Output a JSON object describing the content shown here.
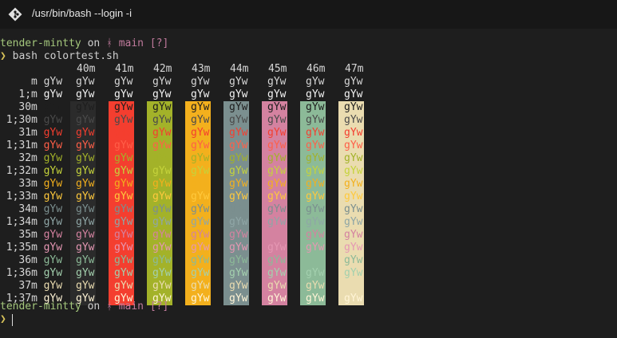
{
  "window": {
    "title": "/usr/bin/bash --login -i"
  },
  "prompt1": {
    "user": "tender-mintty",
    "on": "on",
    "branch_icon": "ᚼ",
    "branch": "main",
    "status": "[?]"
  },
  "command": {
    "chevron": "❯",
    "text": "bash colortest.sh"
  },
  "colortest": {
    "bg_headers": [
      "40m",
      "41m",
      "42m",
      "43m",
      "44m",
      "45m",
      "46m",
      "47m"
    ],
    "sample": "gYw",
    "row_labels": [
      "m",
      "1;m",
      "30m",
      "1;30m",
      "31m",
      "1;31m",
      "32m",
      "1;32m",
      "33m",
      "1;33m",
      "34m",
      "1;34m",
      "35m",
      "1;35m",
      "36m",
      "1;36m",
      "37m",
      "1;37m"
    ],
    "fg_colors": [
      "#d6d6d6",
      "#f2f2f2",
      "#1e1e1e",
      "#4a4a4a",
      "#f43e2f",
      "#ff5f48",
      "#a3b229",
      "#c5d33b",
      "#f3b01d",
      "#ffc93c",
      "#7b8f8f",
      "#8fa6a6",
      "#d482a0",
      "#e597b3",
      "#8cba98",
      "#a3d0ae",
      "#eadcb0",
      "#fff4d6"
    ],
    "bg_colors": [
      "#2b2b2b",
      "#f43e2f",
      "#a3b229",
      "#f3b01d",
      "#7b8f8f",
      "#d482a0",
      "#8cba98",
      "#eadcb0"
    ]
  },
  "prompt2": {
    "user": "tender-mintty",
    "on": "on",
    "branch_icon": "ᚼ",
    "branch": "main",
    "status": "[?]"
  },
  "input": {
    "chevron": "❯"
  }
}
